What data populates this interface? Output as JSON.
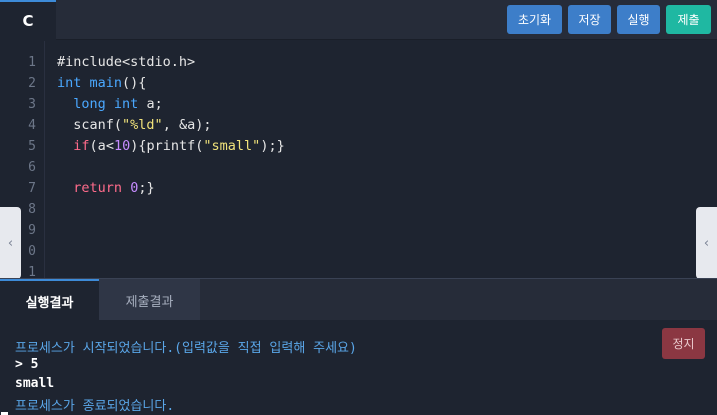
{
  "topbar": {
    "language_tab": "C",
    "buttons": {
      "reset": "초기화",
      "save": "저장",
      "run": "실행",
      "submit": "제출"
    },
    "colors": {
      "blue_button": "#3d7ec9",
      "submit_button": "#1fb8a2"
    }
  },
  "editor": {
    "line_numbers": [
      "1",
      "2",
      "3",
      "4",
      "5",
      "6",
      "7",
      "8",
      "9",
      "0",
      "1"
    ],
    "code": [
      "#include<stdio.h>",
      "int main(){",
      "  long int a;",
      "  scanf(\"%ld\", &a);",
      "  if(a<10){printf(\"small\");}",
      "",
      "  return 0;}",
      "",
      "",
      "",
      ""
    ],
    "left_handle_icon": "chevron-left-icon",
    "right_handle_icon": "chevron-left-icon"
  },
  "result_tabs": {
    "run_result": "실행결과",
    "submit_result": "제출결과"
  },
  "console": {
    "lines": [
      "프로세스가 시작되었습니다.(입력값을 직접 입력해 주세요)",
      "> 5",
      "small",
      "프로세스가 종료되었습니다."
    ],
    "stop_button": "정지"
  }
}
